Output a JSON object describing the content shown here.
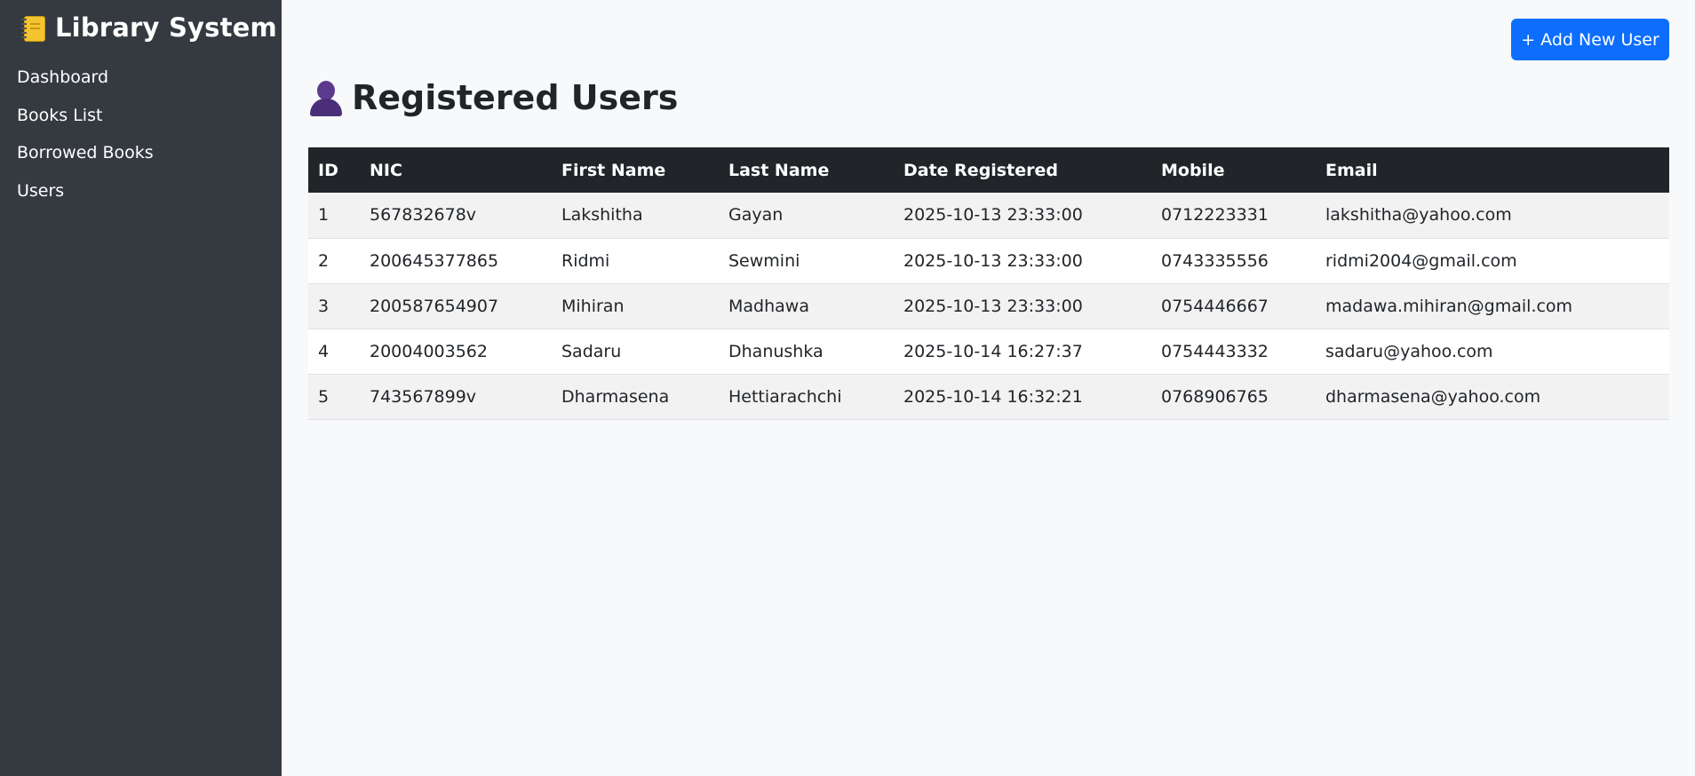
{
  "sidebar": {
    "brand_icon": "notebook-icon",
    "title": "Library System",
    "items": [
      {
        "label": "Dashboard"
      },
      {
        "label": "Books List"
      },
      {
        "label": "Borrowed Books"
      },
      {
        "label": "Users"
      }
    ]
  },
  "header": {
    "add_button_label": "+ Add New User"
  },
  "main": {
    "title_icon": "user-silhouette-icon",
    "title": "Registered Users",
    "table": {
      "columns": [
        "ID",
        "NIC",
        "First Name",
        "Last Name",
        "Date Registered",
        "Mobile",
        "Email"
      ],
      "rows": [
        [
          "1",
          "567832678v",
          "Lakshitha",
          "Gayan",
          "2025-10-13 23:33:00",
          "0712223331",
          "lakshitha@yahoo.com"
        ],
        [
          "2",
          "200645377865",
          "Ridmi",
          "Sewmini",
          "2025-10-13 23:33:00",
          "0743335556",
          "ridmi2004@gmail.com"
        ],
        [
          "3",
          "200587654907",
          "Mihiran",
          "Madhawa",
          "2025-10-13 23:33:00",
          "0754446667",
          "madawa.mihiran@gmail.com"
        ],
        [
          "4",
          "20004003562",
          "Sadaru",
          "Dhanushka",
          "2025-10-14 16:27:37",
          "0754443332",
          "sadaru@yahoo.com"
        ],
        [
          "5",
          "743567899v",
          "Dharmasena",
          "Hettiarachchi",
          "2025-10-14 16:32:21",
          "0768906765",
          "dharmasena@yahoo.com"
        ]
      ]
    }
  },
  "colors": {
    "sidebar_bg": "#343a40",
    "primary": "#0d6efd",
    "table_header_bg": "#212529",
    "page_bg": "#f8f9fa"
  }
}
